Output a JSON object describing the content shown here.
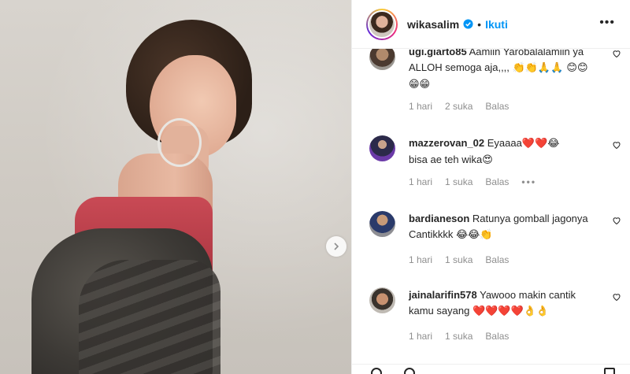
{
  "header": {
    "username": "wikasalim",
    "separator": "•",
    "follow_label": "Ikuti",
    "more_label": "•••",
    "verified_color": "#0095f6"
  },
  "comments": [
    {
      "username": "ugi.giarto85",
      "text": "Aamiin Yarobalalamiin ya ALLOH semoga aja,,,,",
      "emojis": "👏👏🙏🙏 😊😊😁😁",
      "time": "1 hari",
      "likes": "2 suka",
      "reply": "Balas"
    },
    {
      "username": "mazzerovan_02",
      "text": "Eyaaaa",
      "emojis": "❤️❤️😂",
      "text2": "bisa ae teh wika",
      "emojis2": "😍",
      "time": "1 hari",
      "likes": "1 suka",
      "reply": "Balas",
      "options": "•••"
    },
    {
      "username": "bardianeson",
      "text": "Ratunya gomball jagonya Cantikkkk",
      "emojis": "😂😂👏",
      "time": "1 hari",
      "likes": "1 suka",
      "reply": "Balas"
    },
    {
      "username": "jainalarifin578",
      "text": "Yawooo makin cantik kamu sayang",
      "emojis": "❤️❤️❤️❤️👌👌",
      "time": "1 hari",
      "likes": "1 suka",
      "reply": "Balas"
    }
  ],
  "icons": {
    "carousel_next": "chevron-right-icon",
    "like": "heart-outline-icon"
  }
}
